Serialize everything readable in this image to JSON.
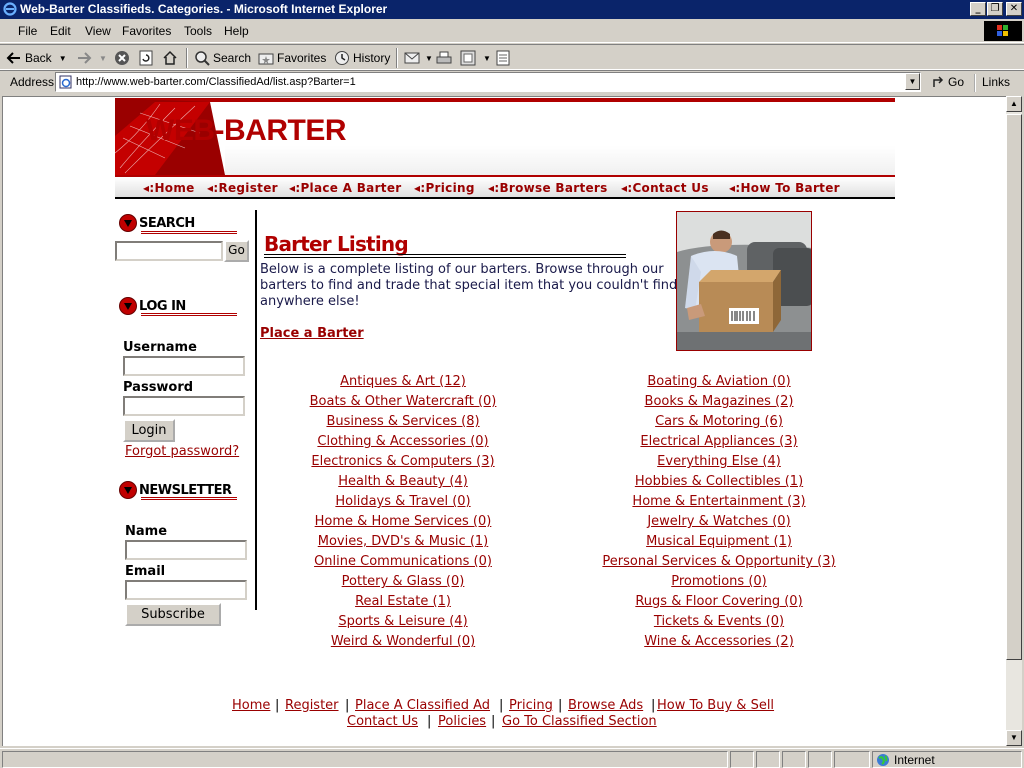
{
  "window": {
    "title": "Web-Barter Classifieds. Categories. - Microsoft Internet Explorer",
    "controls": {
      "minimize": "0",
      "maximize": "1",
      "close": "r"
    }
  },
  "menu": [
    "File",
    "Edit",
    "View",
    "Favorites",
    "Tools",
    "Help"
  ],
  "toolbar": {
    "back": "Back",
    "search": "Search",
    "favorites": "Favorites",
    "history": "History"
  },
  "address": {
    "label": "Address",
    "url": "http://www.web-barter.com/ClassifiedAd/list.asp?Barter=1",
    "go": "Go",
    "links": "Links"
  },
  "status": {
    "zone": "Internet"
  },
  "site": {
    "logo_web": "WEB",
    "logo_dash": "-",
    "logo_barter": "BARTER",
    "nav": [
      "Home",
      "Register",
      "Place A Barter",
      "Pricing",
      "Browse Barters",
      "Contact Us",
      "How To Barter"
    ],
    "nav_prefix": "◂:"
  },
  "sidebar": {
    "search": {
      "heading": "SEARCH",
      "go": "Go"
    },
    "login": {
      "heading": "LOG IN",
      "username": "Username",
      "password": "Password",
      "button": "Login",
      "forgot": "Forgot password?"
    },
    "newsletter": {
      "heading": "NEWSLETTER",
      "name": "Name",
      "email": "Email",
      "button": "Subscribe"
    }
  },
  "main": {
    "heading": "Barter Listing",
    "intro": "Below is a complete listing of our barters. Browse through our barters to find and trade that special item that you couldn't find anywhere else!",
    "place_link": "Place a Barter",
    "categories_left": [
      "Antiques & Art (12)",
      "Boats & Other Watercraft (0)",
      "Business & Services (8)",
      "Clothing & Accessories (0)",
      "Electronics & Computers (3)",
      "Health & Beauty (4)",
      "Holidays & Travel (0)",
      "Home & Home Services (0)",
      "Movies, DVD's & Music (1)",
      "Online Communications (0)",
      "Pottery & Glass (0)",
      "Real Estate (1)",
      "Sports & Leisure (4)",
      "Weird & Wonderful (0)"
    ],
    "categories_right": [
      "Boating & Aviation (0)",
      "Books & Magazines (2)",
      "Cars & Motoring (6)",
      "Electrical Appliances (3)",
      "Everything Else (4)",
      "Hobbies & Collectibles (1)",
      "Home & Entertainment (3)",
      "Jewelry & Watches (0)",
      "Musical Equipment (1)",
      "Personal Services & Opportunity (3)",
      "Promotions (0)",
      "Rugs & Floor Covering (0)",
      "Tickets & Events (0)",
      "Wine & Accessories (2)"
    ]
  },
  "footer": {
    "row1": [
      "Home",
      "Register",
      "Place A Classified Ad",
      "Pricing",
      "Browse Ads",
      "How To Buy & Sell"
    ],
    "row2": [
      "Contact Us",
      "Policies",
      "Go To Classified Section"
    ],
    "sep": "|"
  },
  "colors": {
    "brand_red": "#b00000",
    "link": "#990000",
    "title_bar": "#0a246a"
  }
}
